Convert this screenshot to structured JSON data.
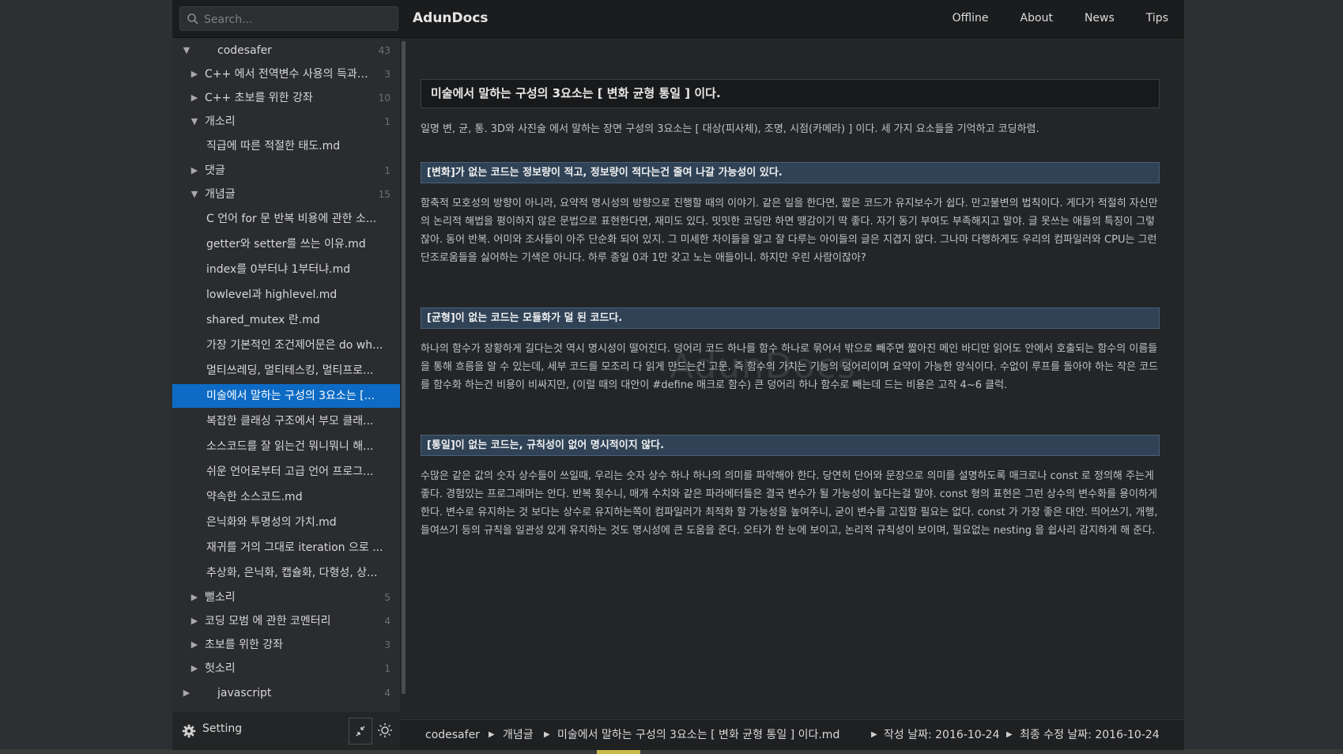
{
  "app": {
    "brand": "AdunDocs"
  },
  "search": {
    "placeholder": "Search..."
  },
  "nav": [
    "Offline",
    "About",
    "News",
    "Tips"
  ],
  "tree": [
    {
      "label": "codesafer",
      "count": "43",
      "arrow": "▼"
    },
    {
      "label": "C++ 에서 전역변수 사용의 득과 실",
      "count": "3",
      "arrow": "▶"
    },
    {
      "label": "C++ 초보를 위한 강좌",
      "count": "10",
      "arrow": "▶"
    },
    {
      "label": "개소리",
      "count": "1",
      "arrow": "▼"
    },
    {
      "label": "직급에 따른 적절한 태도.md",
      "count": "",
      "arrow": ""
    },
    {
      "label": "댓글",
      "count": "1",
      "arrow": "▶"
    },
    {
      "label": "개념글",
      "count": "15",
      "arrow": "▼"
    },
    {
      "label": "C 언어 for 문 반복 비용에 관한 소...",
      "count": "",
      "arrow": ""
    },
    {
      "label": "getter와 setter를 쓰는 이유.md",
      "count": "",
      "arrow": ""
    },
    {
      "label": "index를 0부터냐 1부터냐.md",
      "count": "",
      "arrow": ""
    },
    {
      "label": "lowlevel과 highlevel.md",
      "count": "",
      "arrow": ""
    },
    {
      "label": "shared_mutex 란.md",
      "count": "",
      "arrow": ""
    },
    {
      "label": "가장 기본적인 조건제어문은 do wh...",
      "count": "",
      "arrow": ""
    },
    {
      "label": "멀티쓰레딩, 멀티테스킹, 멀티프로...",
      "count": "",
      "arrow": ""
    },
    {
      "label": "미술에서 말하는 구성의 3요소는 [...",
      "count": "",
      "arrow": ""
    },
    {
      "label": "복잡한 클래싱 구조에서 부모 클래...",
      "count": "",
      "arrow": ""
    },
    {
      "label": "소스코드를 잘 읽는건 뭐니뭐니 해...",
      "count": "",
      "arrow": ""
    },
    {
      "label": "쉬운 언어로부터 고급 언어 프로그...",
      "count": "",
      "arrow": ""
    },
    {
      "label": "약속한 소스코드.md",
      "count": "",
      "arrow": ""
    },
    {
      "label": "은닉화와 투명성의 가치.md",
      "count": "",
      "arrow": ""
    },
    {
      "label": "재귀를 거의 그대로 iteration 으로 ...",
      "count": "",
      "arrow": ""
    },
    {
      "label": "추상화, 은닉화, 캡슐화, 다형성, 상...",
      "count": "",
      "arrow": ""
    },
    {
      "label": "뻘소리",
      "count": "5",
      "arrow": "▶"
    },
    {
      "label": "코딩 모범 에 관한 코멘터리",
      "count": "4",
      "arrow": "▶"
    },
    {
      "label": "초보를 위한 강좌",
      "count": "3",
      "arrow": "▶"
    },
    {
      "label": "헛소리",
      "count": "1",
      "arrow": "▶"
    },
    {
      "label": "javascript",
      "count": "4",
      "arrow": "▶"
    }
  ],
  "sidebar_footer": {
    "setting_label": "Setting"
  },
  "doc": {
    "title": "미술에서 말하는 구성의 3요소는 [ 변화 균형 통일 ] 이다.",
    "intro": "일명 변, 균, 통. 3D와 사진술 에서 말하는 장면 구성의 3요소는 [ 대상(피사체), 조명, 시점(카메라) ] 이다. 세 가지 요소들을 기억하고 코딩하렴.",
    "sections": [
      {
        "heading": "[변화]가 없는 코드는 정보량이 적고, 정보량이 적다는건 줄여 나갈 가능성이 있다.",
        "body": "함축적 모호성의 방향이 아니라, 요약적 명시성의 방향으로 진행할 때의 이야기. 같은 일을 한다면, 짧은 코드가 유지보수가 쉽다. 만고불변의 법칙이다. 게다가 적절히 자신만의 논리적 해법을 평이하지 않은 문법으로 표현한다면, 재미도 있다. 밋밋한 코딩만 하면 땡감이기 딱 좋다. 자기 동기 부여도 부족해지고 말야. 글 못쓰는 애들의 특징이 그렇잖아. 동어 반복. 어미와 조사들이 아주 단순화 되어 있지. 그 미세한 차이들을 알고 잘 다루는 아이들의 글은 지겹지 않다. 그나마 다행하게도 우리의 컴파일러와 CPU는 그런 단조로움들을 싫어하는 기색은 아니다. 하루 종일 0과 1만 갖고 노는 애들이니. 하지만 우린 사람이잖아?"
      },
      {
        "heading": "[균형]이 없는 코드는 모듈화가 덜 된 코드다.",
        "body": "하나의 함수가 장황하게 길다는것 역시 명시성이 떨어진다. 덩어리 코드 하나를 함수 하나로 묶어서 밖으로 빼주면 짧아진 메인 바디만 읽어도 안에서 호출되는 함수의 이름들을 통해 흐름을 알 수 있는데, 세부 코드를 모조리 다 읽게 만드는건 고문. 즉 함수의 가치는 기능의 덩어리이며 요약이 가능한 양식이다. 수없이 루프를 돌아야 하는 작은 코드를 함수화 하는건 비용이 비싸지만, (이럴 때의 대안이 #define 매크로 함수) 큰 덩어리 하나 함수로 빼는데 드는 비용은 고작 4~6 클럭."
      },
      {
        "heading": "[통일]이 없는 코드는, 규칙성이 없어 명시적이지 않다.",
        "body": "수많은 같은 값의 숫자 상수들이 쓰일때, 우리는 숫자 상수 하나 하나의 의미를 파악해야 한다. 당연히 단어와 문장으로 의미를 설명하도록 매크로나 const 로 정의해 주는게 좋다. 경험있는 프로그래머는 안다. 반복 횟수니, 매개 수치와 같은 파라메터들은 결국 변수가 될 가능성이 높다는걸 말야. const 형의 표현은 그런 상수의 변수화를 용이하게 한다. 변수로 유지하는 것 보다는 상수로 유지하는쪽이 컴파일러가 최적화 할 가능성을 높여주니, 굳이 변수를 고집할 필요는 없다. const 가 가장 좋은 대안. 띄어쓰기, 개행, 들여쓰기 등의 규칙을 일관성 있게 유지하는 것도 명시성에 큰 도움을 준다. 오타가 한 눈에 보이고, 논리적 규칙성이 보이며, 필요없는 nesting 을 쉽사리 감지하게 해 준다."
      }
    ],
    "watermark": "AdunDocs"
  },
  "breadcrumb": {
    "root": "codesafer",
    "folder": "개념글",
    "file": "미술에서 말하는 구성의 3요소는 [ 변화 균형 통일 ] 이다.md",
    "created": "작성 날짜: 2016-10-24",
    "modified": "최종 수정 날짜: 2016-10-24"
  }
}
